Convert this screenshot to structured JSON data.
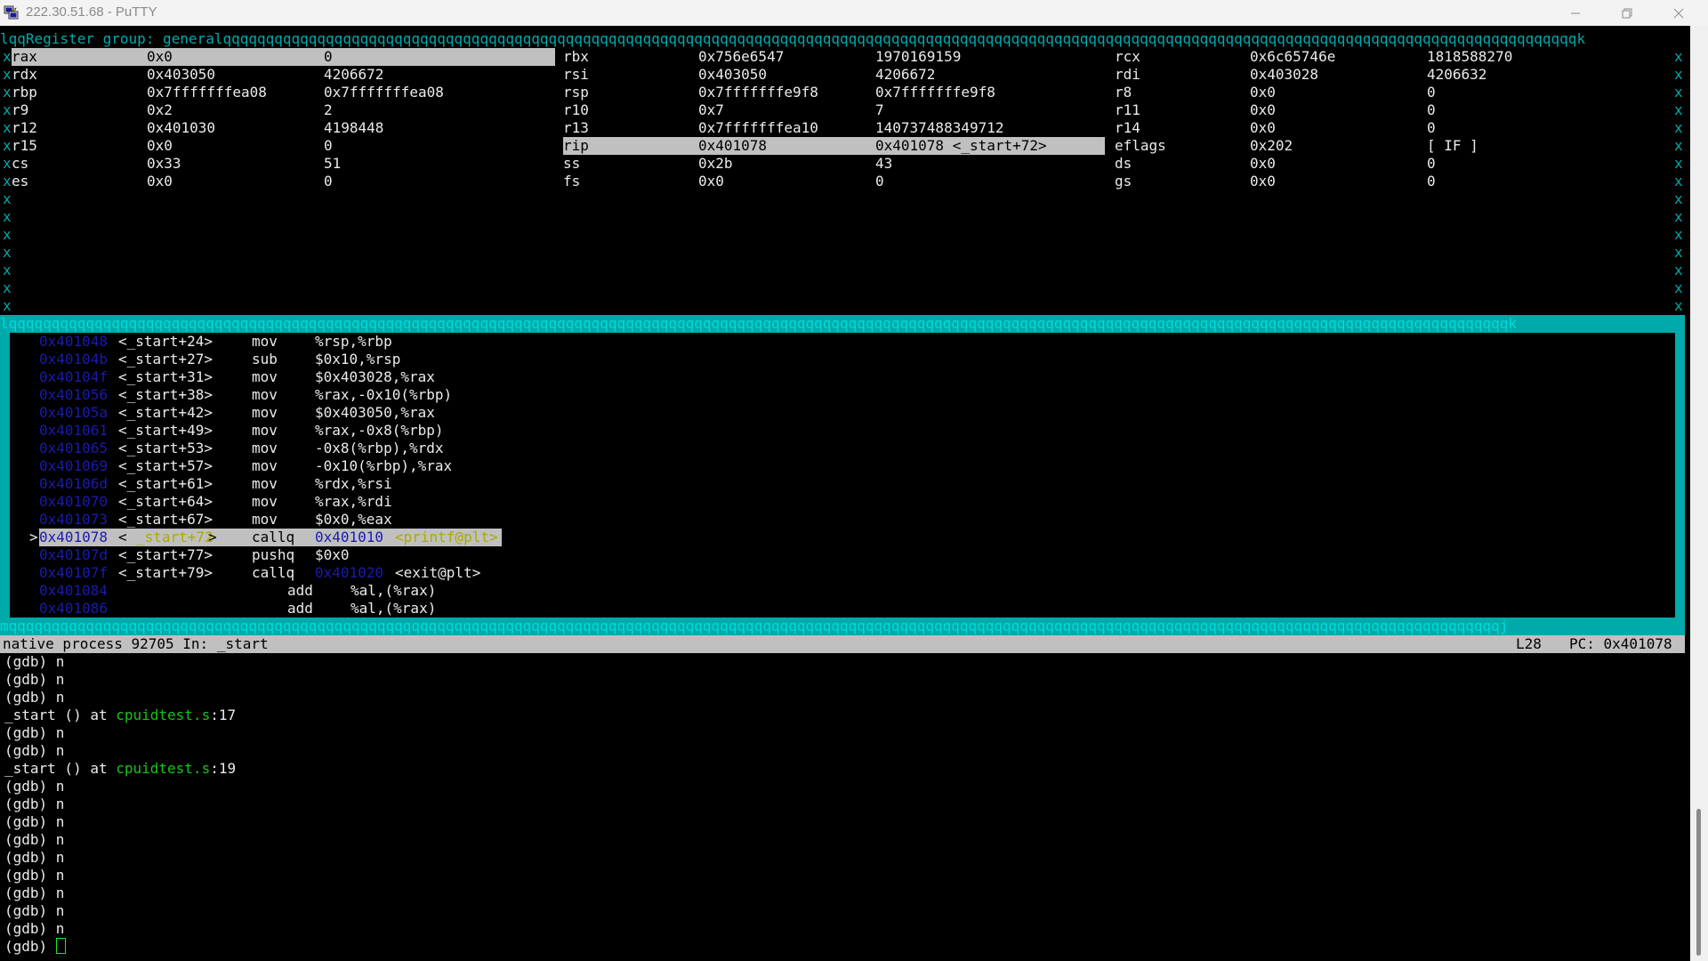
{
  "window": {
    "title": "222.30.51.68 - PuTTY",
    "controls": {
      "minimize": "—",
      "maximize": "❐",
      "close": "✕"
    }
  },
  "register_panel": {
    "header": "lqqRegister group: generalqqqqqqqqqqqqqqqqqqqqqqqqqqqqqqqqqqqqqqqqqqqqqqqqqqqqqqqqqqqqqqqqqqqqqqqqqqqqqqqqqqqqqqqqqqqqqqqqqqqqqqqqqqqqqqqqqqqqqqqqqqqqqqqqqqqqqqqqqqqqqqqqqqqqqqqqqqqqqqk",
    "rows": [
      [
        [
          "rax",
          "0x0",
          "0"
        ],
        [
          "rbx",
          "0x756e6547",
          "1970169159"
        ],
        [
          "rcx",
          "0x6c65746e",
          "1818588270"
        ]
      ],
      [
        [
          "rdx",
          "0x403050",
          "4206672"
        ],
        [
          "rsi",
          "0x403050",
          "4206672"
        ],
        [
          "rdi",
          "0x403028",
          "4206632"
        ]
      ],
      [
        [
          "rbp",
          "0x7fffffffea08",
          "0x7fffffffea08"
        ],
        [
          "rsp",
          "0x7fffffffe9f8",
          "0x7fffffffe9f8"
        ],
        [
          "r8",
          "0x0",
          "0"
        ]
      ],
      [
        [
          "r9",
          "0x2",
          "2"
        ],
        [
          "r10",
          "0x7",
          "7"
        ],
        [
          "r11",
          "0x0",
          "0"
        ]
      ],
      [
        [
          "r12",
          "0x401030",
          "4198448"
        ],
        [
          "r13",
          "0x7fffffffea10",
          "140737488349712"
        ],
        [
          "r14",
          "0x0",
          "0"
        ]
      ],
      [
        [
          "r15",
          "0x0",
          "0"
        ],
        [
          "rip",
          "0x401078",
          "0x401078 <_start+72>"
        ],
        [
          "eflags",
          "0x202",
          "[ IF ]"
        ]
      ],
      [
        [
          "cs",
          "0x33",
          "51"
        ],
        [
          "ss",
          "0x2b",
          "43"
        ],
        [
          "ds",
          "0x0",
          "0"
        ]
      ],
      [
        [
          "es",
          "0x0",
          "0"
        ],
        [
          "fs",
          "0x0",
          "0"
        ],
        [
          "gs",
          "0x0",
          "0"
        ]
      ]
    ],
    "border_char": "x"
  },
  "asm_panel": {
    "top_border": "lqqqqqqqqqqqqqqqqqqqqqqqqqqqqqqqqqqqqqqqqqqqqqqqqqqqqqqqqqqqqqqqqqqqqqqqqqqqqqqqqqqqqqqqqqqqqqqqqqqqqqqqqqqqqqqqqqqqqqqqqqqqqqqqqqqqqqqqqqqqqqqqqqqqqqqqqqqqqqqqqqqqqqqqqqqqqqqqk",
    "bottom_border": "mqqqqqqqqqqqqqqqqqqqqqqqqqqqqqqqqqqqqqqqqqqqqqqqqqqqqqqqqqqqqqqqqqqqqqqqqqqqqqqqqqqqqqqqqqqqqqqqqqqqqqqqqqqqqqqqqqqqqqqqqqqqqqqqqqqqqqqqqqqqqqqqqqqqqqqqqqqqqqqqqqqqqqqqqqqqqqqj",
    "current_marker": ">",
    "lines": [
      {
        "addr": "0x401048",
        "label": "<_start+24>",
        "op": "mov",
        "args": "%rsp,%rbp"
      },
      {
        "addr": "0x40104b",
        "label": "<_start+27>",
        "op": "sub",
        "args": "$0x10,%rsp"
      },
      {
        "addr": "0x40104f",
        "label": "<_start+31>",
        "op": "mov",
        "args": "$0x403028,%rax"
      },
      {
        "addr": "0x401056",
        "label": "<_start+38>",
        "op": "mov",
        "args": "%rax,-0x10(%rbp)"
      },
      {
        "addr": "0x40105a",
        "label": "<_start+42>",
        "op": "mov",
        "args": "$0x403050,%rax"
      },
      {
        "addr": "0x401061",
        "label": "<_start+49>",
        "op": "mov",
        "args": "%rax,-0x8(%rbp)"
      },
      {
        "addr": "0x401065",
        "label": "<_start+53>",
        "op": "mov",
        "args": "-0x8(%rbp),%rdx"
      },
      {
        "addr": "0x401069",
        "label": "<_start+57>",
        "op": "mov",
        "args": "-0x10(%rbp),%rax"
      },
      {
        "addr": "0x40106d",
        "label": "<_start+61>",
        "op": "mov",
        "args": "%rdx,%rsi"
      },
      {
        "addr": "0x401070",
        "label": "<_start+64>",
        "op": "mov",
        "args": "%rax,%rdi"
      },
      {
        "addr": "0x401073",
        "label": "<_start+67>",
        "op": "mov",
        "args": "$0x0,%eax"
      },
      {
        "addr": "0x401078",
        "label_pre": "< ",
        "label_sym": "_start+72",
        "label_post": ">",
        "op": "callq",
        "target": "0x401010",
        "sym": "<printf@plt>",
        "current": true
      },
      {
        "addr": "0x40107d",
        "label": "<_start+77>",
        "op": "pushq",
        "args": "$0x0"
      },
      {
        "addr": "0x40107f",
        "label": "<_start+79>",
        "op": "callq",
        "target": "0x401020",
        "sym": "<exit@plt>"
      },
      {
        "addr": "0x401084",
        "label": "",
        "op": "add",
        "args": "%al,(%rax)",
        "indent": true
      },
      {
        "addr": "0x401086",
        "label": "",
        "op": "add",
        "args": "%al,(%rax)",
        "indent": true
      }
    ]
  },
  "status_bar": {
    "left": "native process 92705 In: _start",
    "line": "L28",
    "pc": "PC: 0x401078"
  },
  "console": {
    "lines": [
      "(gdb) n",
      "(gdb) n",
      "(gdb) n",
      {
        "pre": "_start () at ",
        "file": "cpuidtest.s",
        "post": ":17"
      },
      "(gdb) n",
      "(gdb) n",
      {
        "pre": "_start () at ",
        "file": "cpuidtest.s",
        "post": ":19"
      },
      "(gdb) n",
      "(gdb) n",
      "(gdb) n",
      "(gdb) n",
      "(gdb) n",
      "(gdb) n",
      "(gdb) n",
      "(gdb) n",
      "(gdb) n"
    ],
    "prompt": "(gdb) "
  },
  "colors": {
    "cyan": "#00aaaa",
    "selection": "#c0c0c0",
    "address_blue": "#1a1ab0",
    "symbol_yellow": "#aaaa00",
    "file_green": "#18c418"
  }
}
